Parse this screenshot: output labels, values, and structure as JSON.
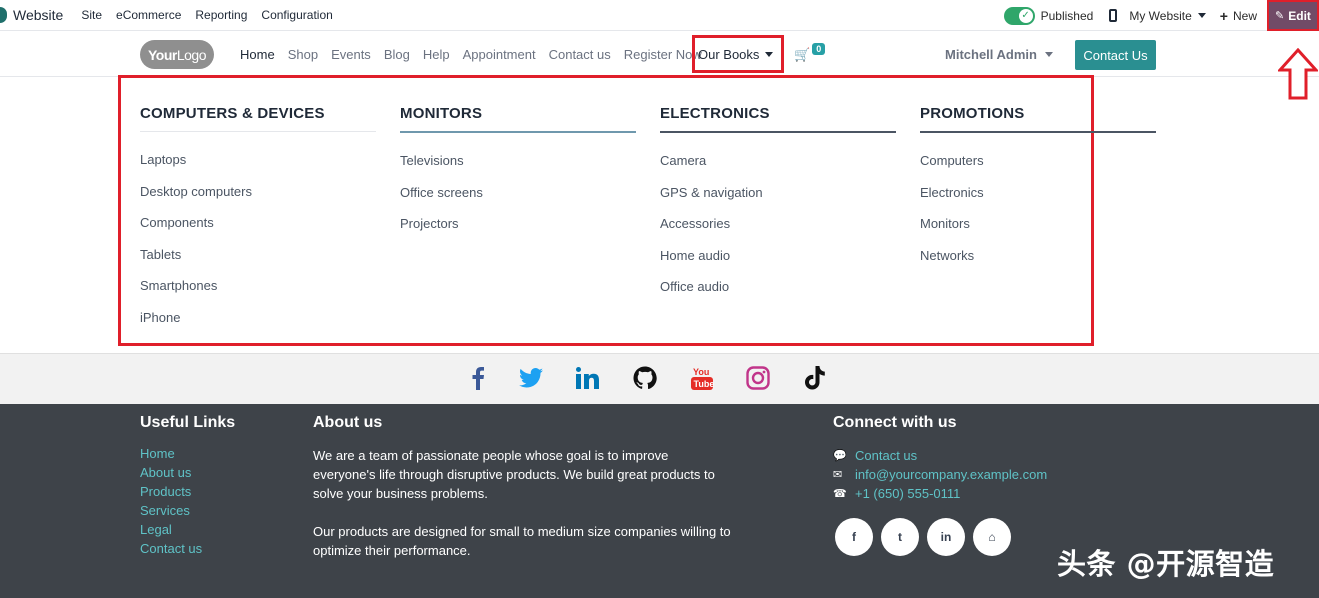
{
  "adminbar": {
    "app_label": "Website",
    "menu": [
      "Site",
      "eCommerce",
      "Reporting",
      "Configuration"
    ],
    "published_label": "Published",
    "website_label": "My Website",
    "new_label": "New",
    "edit_label": "Edit"
  },
  "header": {
    "logo_text_bold": "Your",
    "logo_text_light": "Logo",
    "nav": [
      "Home",
      "Shop",
      "Events",
      "Blog",
      "Help",
      "Appointment",
      "Contact us",
      "Register Now"
    ],
    "active_nav": "Home",
    "books_label": "Our Books",
    "cart_count": "0",
    "user_name": "Mitchell Admin",
    "contact_button": "Contact Us"
  },
  "megamenu": {
    "columns": [
      {
        "title": "COMPUTERS & DEVICES",
        "items": [
          "Laptops",
          "Desktop computers",
          "Components",
          "Tablets",
          "Smartphones",
          "iPhone"
        ]
      },
      {
        "title": "MONITORS",
        "items": [
          "Televisions",
          "Office screens",
          "Projectors"
        ]
      },
      {
        "title": "ELECTRONICS",
        "items": [
          "Camera",
          "GPS & navigation",
          "Accessories",
          "Home audio",
          "Office audio"
        ]
      },
      {
        "title": "PROMOTIONS",
        "items": [
          "Computers",
          "Electronics",
          "Monitors",
          "Networks"
        ]
      }
    ]
  },
  "social": [
    "facebook-icon",
    "twitter-icon",
    "linkedin-icon",
    "github-icon",
    "youtube-icon",
    "instagram-icon",
    "tiktok-icon"
  ],
  "footer": {
    "useful_links_title": "Useful Links",
    "useful_links": [
      "Home",
      "About us",
      "Products",
      "Services",
      "Legal",
      "Contact us"
    ],
    "about_title": "About us",
    "about_p1": "We are a team of passionate people whose goal is to improve everyone's life through disruptive products. We build great products to solve your business problems.",
    "about_p2": "Our products are designed for small to medium size companies willing to optimize their performance.",
    "connect_title": "Connect with us",
    "contact_us": "Contact us",
    "email": "info@yourcompany.example.com",
    "phone": "+1 (650) 555-0111",
    "circle_icons": [
      "f",
      "t",
      "in",
      "⌂"
    ]
  },
  "watermark": "头条 @开源智造",
  "colors": {
    "accent": "#2a8f91",
    "highlight": "#e01f2a",
    "footer_bg": "#3e4349",
    "link": "#5fc3c7"
  }
}
